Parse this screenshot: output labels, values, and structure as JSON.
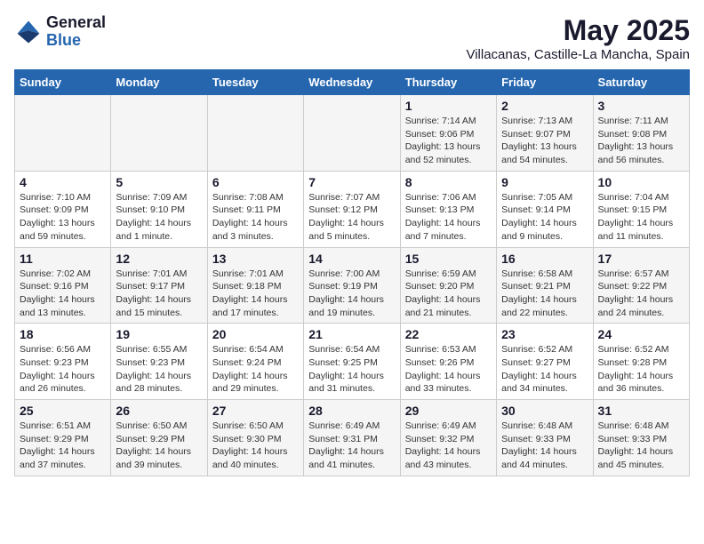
{
  "logo": {
    "general": "General",
    "blue": "Blue"
  },
  "header": {
    "title": "May 2025",
    "subtitle": "Villacanas, Castille-La Mancha, Spain"
  },
  "weekdays": [
    "Sunday",
    "Monday",
    "Tuesday",
    "Wednesday",
    "Thursday",
    "Friday",
    "Saturday"
  ],
  "weeks": [
    [
      {
        "day": "",
        "info": ""
      },
      {
        "day": "",
        "info": ""
      },
      {
        "day": "",
        "info": ""
      },
      {
        "day": "",
        "info": ""
      },
      {
        "day": "1",
        "info": "Sunrise: 7:14 AM\nSunset: 9:06 PM\nDaylight: 13 hours and 52 minutes."
      },
      {
        "day": "2",
        "info": "Sunrise: 7:13 AM\nSunset: 9:07 PM\nDaylight: 13 hours and 54 minutes."
      },
      {
        "day": "3",
        "info": "Sunrise: 7:11 AM\nSunset: 9:08 PM\nDaylight: 13 hours and 56 minutes."
      }
    ],
    [
      {
        "day": "4",
        "info": "Sunrise: 7:10 AM\nSunset: 9:09 PM\nDaylight: 13 hours and 59 minutes."
      },
      {
        "day": "5",
        "info": "Sunrise: 7:09 AM\nSunset: 9:10 PM\nDaylight: 14 hours and 1 minute."
      },
      {
        "day": "6",
        "info": "Sunrise: 7:08 AM\nSunset: 9:11 PM\nDaylight: 14 hours and 3 minutes."
      },
      {
        "day": "7",
        "info": "Sunrise: 7:07 AM\nSunset: 9:12 PM\nDaylight: 14 hours and 5 minutes."
      },
      {
        "day": "8",
        "info": "Sunrise: 7:06 AM\nSunset: 9:13 PM\nDaylight: 14 hours and 7 minutes."
      },
      {
        "day": "9",
        "info": "Sunrise: 7:05 AM\nSunset: 9:14 PM\nDaylight: 14 hours and 9 minutes."
      },
      {
        "day": "10",
        "info": "Sunrise: 7:04 AM\nSunset: 9:15 PM\nDaylight: 14 hours and 11 minutes."
      }
    ],
    [
      {
        "day": "11",
        "info": "Sunrise: 7:02 AM\nSunset: 9:16 PM\nDaylight: 14 hours and 13 minutes."
      },
      {
        "day": "12",
        "info": "Sunrise: 7:01 AM\nSunset: 9:17 PM\nDaylight: 14 hours and 15 minutes."
      },
      {
        "day": "13",
        "info": "Sunrise: 7:01 AM\nSunset: 9:18 PM\nDaylight: 14 hours and 17 minutes."
      },
      {
        "day": "14",
        "info": "Sunrise: 7:00 AM\nSunset: 9:19 PM\nDaylight: 14 hours and 19 minutes."
      },
      {
        "day": "15",
        "info": "Sunrise: 6:59 AM\nSunset: 9:20 PM\nDaylight: 14 hours and 21 minutes."
      },
      {
        "day": "16",
        "info": "Sunrise: 6:58 AM\nSunset: 9:21 PM\nDaylight: 14 hours and 22 minutes."
      },
      {
        "day": "17",
        "info": "Sunrise: 6:57 AM\nSunset: 9:22 PM\nDaylight: 14 hours and 24 minutes."
      }
    ],
    [
      {
        "day": "18",
        "info": "Sunrise: 6:56 AM\nSunset: 9:23 PM\nDaylight: 14 hours and 26 minutes."
      },
      {
        "day": "19",
        "info": "Sunrise: 6:55 AM\nSunset: 9:23 PM\nDaylight: 14 hours and 28 minutes."
      },
      {
        "day": "20",
        "info": "Sunrise: 6:54 AM\nSunset: 9:24 PM\nDaylight: 14 hours and 29 minutes."
      },
      {
        "day": "21",
        "info": "Sunrise: 6:54 AM\nSunset: 9:25 PM\nDaylight: 14 hours and 31 minutes."
      },
      {
        "day": "22",
        "info": "Sunrise: 6:53 AM\nSunset: 9:26 PM\nDaylight: 14 hours and 33 minutes."
      },
      {
        "day": "23",
        "info": "Sunrise: 6:52 AM\nSunset: 9:27 PM\nDaylight: 14 hours and 34 minutes."
      },
      {
        "day": "24",
        "info": "Sunrise: 6:52 AM\nSunset: 9:28 PM\nDaylight: 14 hours and 36 minutes."
      }
    ],
    [
      {
        "day": "25",
        "info": "Sunrise: 6:51 AM\nSunset: 9:29 PM\nDaylight: 14 hours and 37 minutes."
      },
      {
        "day": "26",
        "info": "Sunrise: 6:50 AM\nSunset: 9:29 PM\nDaylight: 14 hours and 39 minutes."
      },
      {
        "day": "27",
        "info": "Sunrise: 6:50 AM\nSunset: 9:30 PM\nDaylight: 14 hours and 40 minutes."
      },
      {
        "day": "28",
        "info": "Sunrise: 6:49 AM\nSunset: 9:31 PM\nDaylight: 14 hours and 41 minutes."
      },
      {
        "day": "29",
        "info": "Sunrise: 6:49 AM\nSunset: 9:32 PM\nDaylight: 14 hours and 43 minutes."
      },
      {
        "day": "30",
        "info": "Sunrise: 6:48 AM\nSunset: 9:33 PM\nDaylight: 14 hours and 44 minutes."
      },
      {
        "day": "31",
        "info": "Sunrise: 6:48 AM\nSunset: 9:33 PM\nDaylight: 14 hours and 45 minutes."
      }
    ]
  ]
}
